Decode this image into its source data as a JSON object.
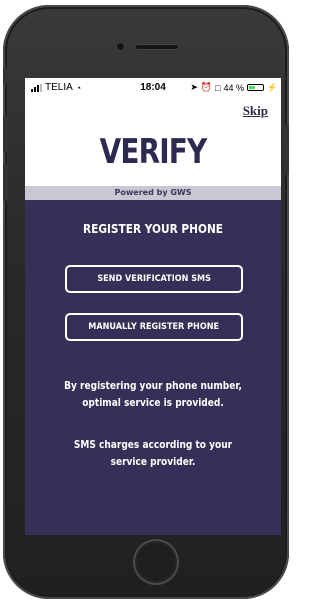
{
  "status_bar": {
    "carrier": "TELIA",
    "time": "18:04",
    "battery_percent": "44 %",
    "battery_level": 0.44
  },
  "header": {
    "skip_label": "Skip",
    "title": "VERIFY",
    "powered_by": "Powered by GWS"
  },
  "main": {
    "section_title": "REGISTER YOUR PHONE",
    "send_sms_label": "SEND VERIFICATION SMS",
    "manual_register_label": "MANUALLY REGISTER PHONE",
    "info_lines": [
      "By registering your phone number,",
      "optimal service is provided."
    ],
    "sms_lines": [
      "SMS charges according to your",
      "service provider."
    ]
  },
  "colors": {
    "background": "#363058",
    "brand": "#2d2a52",
    "powered_strip": "#c9c7d2"
  }
}
